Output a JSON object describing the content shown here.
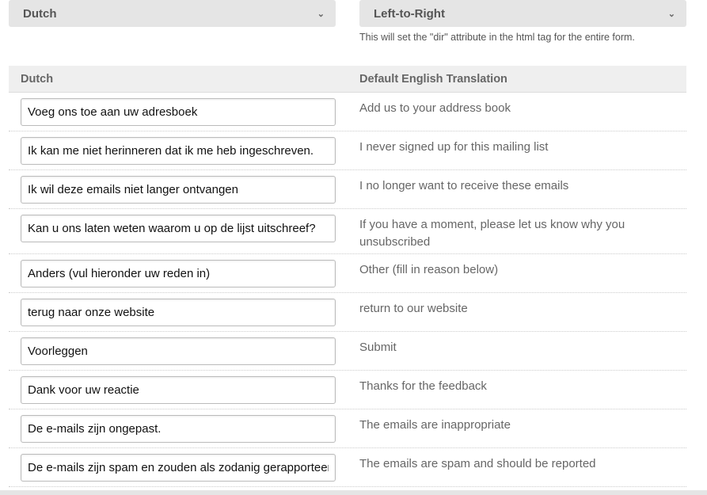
{
  "language_select": {
    "value": "Dutch"
  },
  "direction_select": {
    "value": "Left-to-Right",
    "help": "This will set the \"dir\" attribute in the html tag for the entire form."
  },
  "table": {
    "headers": [
      "Dutch",
      "Default English Translation"
    ],
    "rows": [
      {
        "value": "Voeg ons toe aan uw adresboek",
        "english": "Add us to your address book"
      },
      {
        "value": "Ik kan me niet herinneren dat ik me heb ingeschreven.",
        "english": "I never signed up for this mailing list"
      },
      {
        "value": "Ik wil deze emails niet langer ontvangen",
        "english": "I no longer want to receive these emails"
      },
      {
        "value": "Kan u ons laten weten waarom u op de lijst uitschreef?",
        "english": "If you have a moment, please let us know why you unsubscribed"
      },
      {
        "value": "Anders (vul hieronder uw reden in)",
        "english": "Other (fill in reason below)"
      },
      {
        "value": "terug naar onze website",
        "english": "return to our website"
      },
      {
        "value": "Voorleggen",
        "english": "Submit"
      },
      {
        "value": "Dank voor uw reactie",
        "english": "Thanks for the feedback"
      },
      {
        "value": "De e-mails zijn ongepast.",
        "english": "The emails are inappropriate"
      },
      {
        "value": "De e-mails zijn spam en zouden als zodanig gerapporteerd moeten worden.",
        "english": "The emails are spam and should be reported"
      }
    ]
  }
}
